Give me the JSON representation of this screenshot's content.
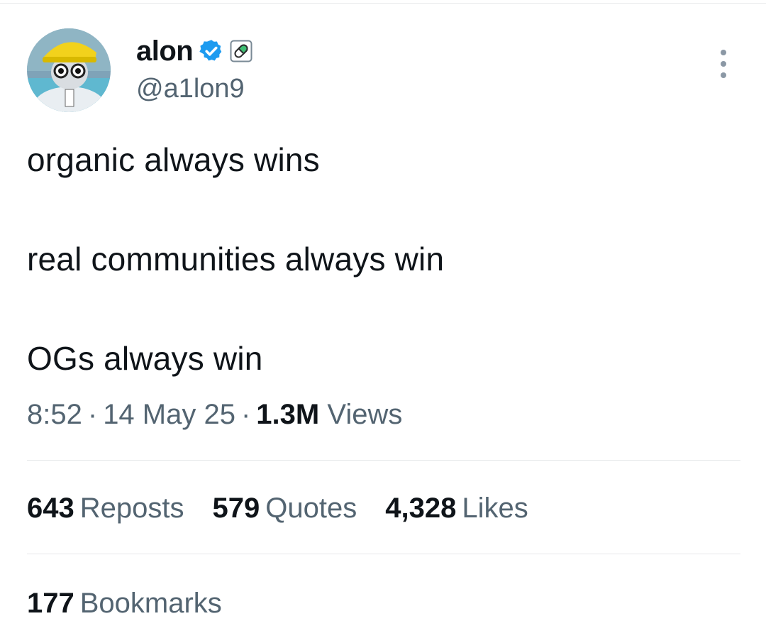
{
  "author": {
    "display_name": "alon",
    "handle": "@a1lon9",
    "avatar_icon": "avatar-cartoon-hardhat",
    "verified_icon": "verified-badge-icon",
    "affiliate_icon": "pill-badge-icon",
    "verified_color": "#1d9bf0"
  },
  "tweet": {
    "lines": [
      "organic always wins",
      "real communities always win",
      "OGs always win"
    ]
  },
  "meta": {
    "time": "8:52",
    "separator": "·",
    "date": "14 May 25",
    "views_count": "1.3M",
    "views_label": "Views"
  },
  "stats": {
    "reposts_count": "643",
    "reposts_label": "Reposts",
    "quotes_count": "579",
    "quotes_label": "Quotes",
    "likes_count": "4,328",
    "likes_label": "Likes",
    "bookmarks_count": "177",
    "bookmarks_label": "Bookmarks"
  },
  "colors": {
    "text_primary": "#0f1419",
    "text_secondary": "#536471",
    "divider": "#e6e8ea"
  }
}
